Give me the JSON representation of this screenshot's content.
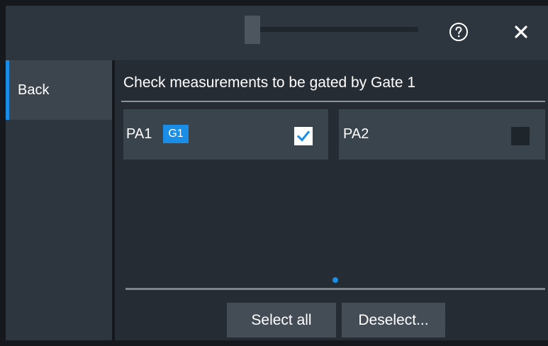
{
  "header": {
    "help_icon": "help-circle-icon",
    "close_icon": "close-icon"
  },
  "sidebar": {
    "back_label": "Back"
  },
  "main": {
    "title": "Check measurements to be gated by Gate 1",
    "measurements": [
      {
        "label": "PA1",
        "badge": "G1",
        "checked": true
      },
      {
        "label": "PA2",
        "checked": false
      }
    ],
    "pages": {
      "current": 1,
      "total": 1
    },
    "buttons": {
      "select_all": "Select all",
      "deselect": "Deselect..."
    }
  },
  "colors": {
    "accent": "#1a8ee6",
    "panel": "#2d363e",
    "card": "#3a444c",
    "button": "#444d55"
  }
}
